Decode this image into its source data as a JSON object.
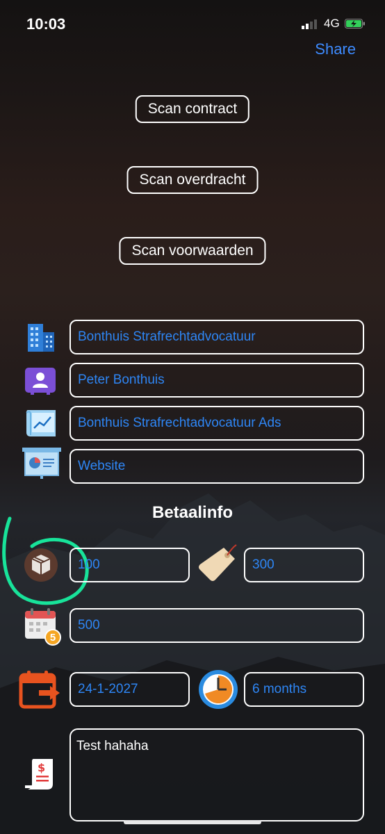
{
  "status_bar": {
    "time": "10:03",
    "network": "4G"
  },
  "header": {
    "share_label": "Share"
  },
  "scan_buttons": {
    "contract": "Scan contract",
    "overdracht": "Scan overdracht",
    "voorwaarden": "Scan voorwaarden"
  },
  "details": {
    "company": "Bonthuis Strafrechtadvocatuur",
    "contact": "Peter Bonthuis",
    "account": "Bonthuis Strafrechtadvocatuur Ads",
    "channel": "Website"
  },
  "payment": {
    "section_title": "Betaalinfo",
    "amount_one": "100",
    "price": "300",
    "monthly": "500",
    "calendar_badge": "5",
    "end_date": "24-1-2027",
    "duration": "6 months",
    "notes": "Test hahaha"
  },
  "colors": {
    "accent": "#3d8bff",
    "field_text": "#2e86f5",
    "annotation": "#18e39a"
  }
}
